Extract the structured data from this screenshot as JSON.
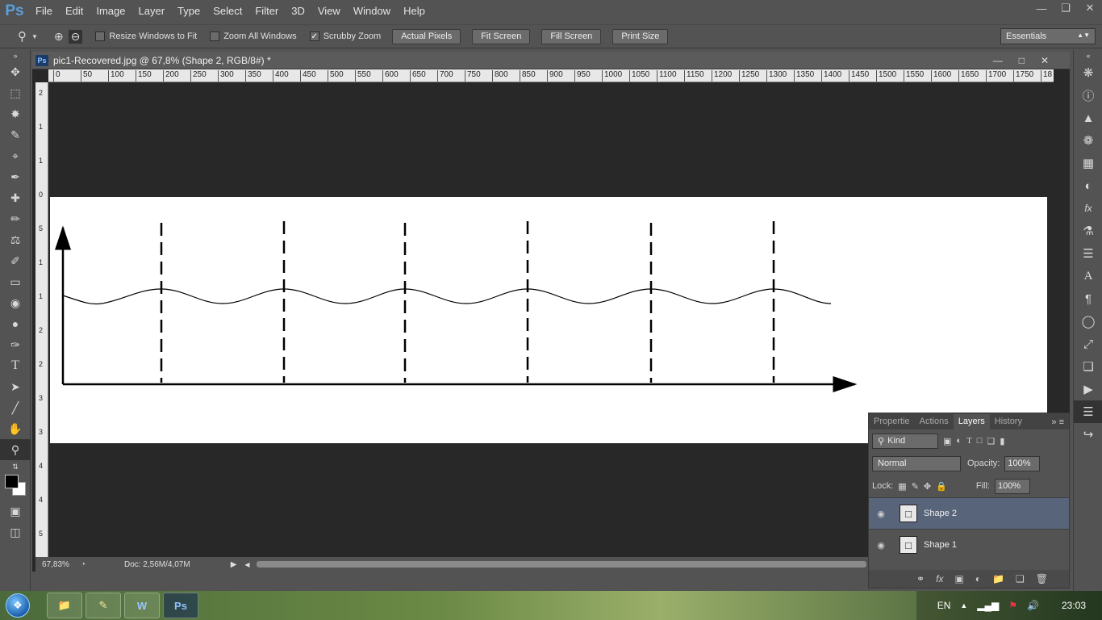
{
  "app": {
    "logo": "Ps"
  },
  "menu": [
    "File",
    "Edit",
    "Image",
    "Layer",
    "Type",
    "Select",
    "Filter",
    "3D",
    "View",
    "Window",
    "Help"
  ],
  "options_bar": {
    "checkboxes": [
      {
        "label": "Resize Windows to Fit",
        "checked": false
      },
      {
        "label": "Zoom All Windows",
        "checked": false
      },
      {
        "label": "Scrubby Zoom",
        "checked": true
      }
    ],
    "buttons": [
      "Actual Pixels",
      "Fit Screen",
      "Fill Screen",
      "Print Size"
    ],
    "workspace": "Essentials"
  },
  "document": {
    "title": "pic1-Recovered.jpg @ 67,8% (Shape 2, RGB/8#) *",
    "zoom": "67,83%",
    "doc_size": "Doc: 2,56M/4,07M"
  },
  "ruler": {
    "h_labels": [
      "0",
      "50",
      "100",
      "150",
      "200",
      "250",
      "300",
      "350",
      "400",
      "450",
      "500",
      "550",
      "600",
      "650",
      "700",
      "750",
      "800",
      "850",
      "900",
      "950",
      "1000",
      "1050",
      "1100",
      "1150",
      "1200",
      "1250",
      "1300",
      "1350",
      "1400",
      "1450",
      "1500",
      "1550",
      "1600",
      "1650",
      "1700",
      "1750",
      "18"
    ],
    "v_labels": [
      "2",
      "1",
      "1",
      "0",
      "5",
      "1",
      "1",
      "2",
      "2",
      "3",
      "3",
      "4",
      "4",
      "5"
    ]
  },
  "layers_panel": {
    "tabs": [
      "Propertie",
      "Actions",
      "Layers",
      "History"
    ],
    "active_tab": "Layers",
    "kind_label": "Kind",
    "blend_mode": "Normal",
    "opacity_label": "Opacity:",
    "opacity_value": "100%",
    "lock_label": "Lock:",
    "fill_label": "Fill:",
    "fill_value": "100%",
    "layers": [
      {
        "name": "Shape 2",
        "selected": true
      },
      {
        "name": "Shape 1",
        "selected": false
      }
    ]
  },
  "taskbar": {
    "apps": [
      "Explorer",
      "Notes",
      "W",
      "Ps"
    ],
    "lang": "EN",
    "time": "23:03"
  },
  "colors": {
    "accent": "#58647a",
    "ps_blue": "#5aa0e0"
  }
}
